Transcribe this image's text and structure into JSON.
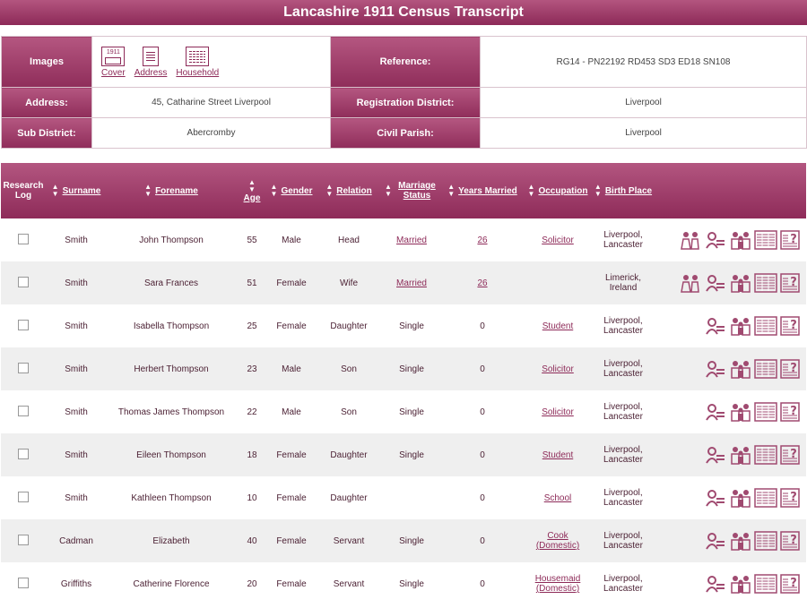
{
  "title": "Lancashire 1911 Census Transcript",
  "info": {
    "images_label": "Images",
    "image_links": [
      "Cover",
      "Address",
      "Household"
    ],
    "reference_label": "Reference:",
    "reference_value": "RG14 - PN22192 RD453 SD3 ED18 SN108",
    "address_label": "Address:",
    "address_value": "45, Catharine Street Liverpool",
    "reg_district_label": "Registration District:",
    "reg_district_value": "Liverpool",
    "sub_district_label": "Sub District:",
    "sub_district_value": "Abercromby",
    "civil_parish_label": "Civil Parish:",
    "civil_parish_value": "Liverpool"
  },
  "columns": {
    "research_log": "Research Log",
    "surname": "Surname",
    "forename": "Forename",
    "age": "Age",
    "gender": "Gender",
    "relation": "Relation",
    "marriage_status": "Marriage Status",
    "years_married": "Years Married",
    "occupation": "Occupation",
    "birth_place": "Birth Place"
  },
  "rows": [
    {
      "surname": "Smith",
      "forename": "John Thompson",
      "age": "55",
      "gender": "Male",
      "relation": "Head",
      "marriage": "Married",
      "years": "26",
      "occupation": "Solicitor",
      "birth": "Liverpool, Lancaster",
      "couple": true
    },
    {
      "surname": "Smith",
      "forename": "Sara Frances",
      "age": "51",
      "gender": "Female",
      "relation": "Wife",
      "marriage": "Married",
      "years": "26",
      "occupation": "",
      "birth": "Limerick, Ireland",
      "couple": true
    },
    {
      "surname": "Smith",
      "forename": "Isabella Thompson",
      "age": "25",
      "gender": "Female",
      "relation": "Daughter",
      "marriage": "Single",
      "years": "0",
      "occupation": "Student",
      "birth": "Liverpool, Lancaster",
      "couple": false
    },
    {
      "surname": "Smith",
      "forename": "Herbert Thompson",
      "age": "23",
      "gender": "Male",
      "relation": "Son",
      "marriage": "Single",
      "years": "0",
      "occupation": "Solicitor",
      "birth": "Liverpool, Lancaster",
      "couple": false
    },
    {
      "surname": "Smith",
      "forename": "Thomas James Thompson",
      "age": "22",
      "gender": "Male",
      "relation": "Son",
      "marriage": "Single",
      "years": "0",
      "occupation": "Solicitor",
      "birth": "Liverpool, Lancaster",
      "couple": false
    },
    {
      "surname": "Smith",
      "forename": "Eileen Thompson",
      "age": "18",
      "gender": "Female",
      "relation": "Daughter",
      "marriage": "Single",
      "years": "0",
      "occupation": "Student",
      "birth": "Liverpool, Lancaster",
      "couple": false
    },
    {
      "surname": "Smith",
      "forename": "Kathleen Thompson",
      "age": "10",
      "gender": "Female",
      "relation": "Daughter",
      "marriage": "",
      "years": "0",
      "occupation": "School",
      "birth": "Liverpool, Lancaster",
      "couple": false
    },
    {
      "surname": "Cadman",
      "forename": "Elizabeth",
      "age": "40",
      "gender": "Female",
      "relation": "Servant",
      "marriage": "Single",
      "years": "0",
      "occupation": "Cook (Domestic)",
      "birth": "Liverpool, Lancaster",
      "couple": false
    },
    {
      "surname": "Griffiths",
      "forename": "Catherine Florence",
      "age": "20",
      "gender": "Female",
      "relation": "Servant",
      "marriage": "Single",
      "years": "0",
      "occupation": "Housemaid (Domestic)",
      "birth": "Liverpool, Lancaster",
      "couple": false
    }
  ],
  "colors": {
    "accent": "#8d2a58",
    "accent_light": "#b3557f",
    "row_alt": "#efefef"
  },
  "icons": [
    "couple-icon",
    "link-person-icon",
    "family-icon",
    "transcript-icon",
    "query-icon"
  ]
}
